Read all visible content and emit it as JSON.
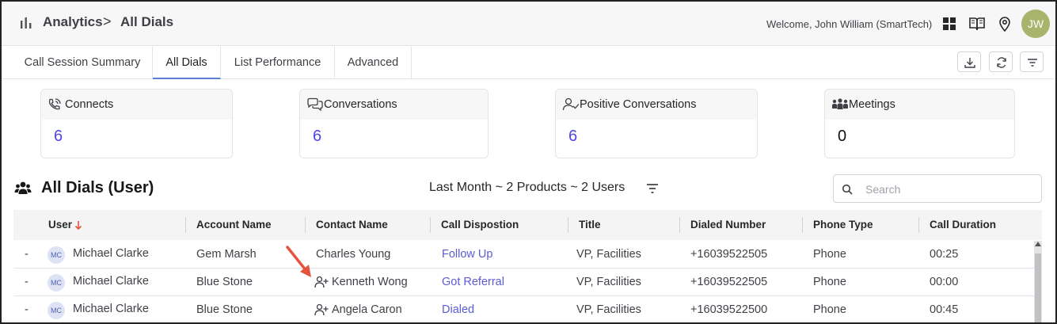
{
  "header": {
    "app": "Analytics",
    "separator": ">",
    "page": "All Dials",
    "welcome": "Welcome, John William (SmartTech)",
    "avatar_initials": "JW",
    "avatar_color": "#a8b36b",
    "icons": [
      "bar-chart-icon",
      "grid-icon",
      "book-icon",
      "location-pin-icon"
    ]
  },
  "tabs": [
    {
      "label": "Call Session Summary",
      "active": false
    },
    {
      "label": "All Dials",
      "active": true
    },
    {
      "label": "List Performance",
      "active": false
    },
    {
      "label": "Advanced",
      "active": false
    }
  ],
  "toolbar": {
    "icons": [
      "download-icon",
      "refresh-icon",
      "filter-lines-icon"
    ]
  },
  "kpis": [
    {
      "label": "Connects",
      "value": "6",
      "icon": "phone-connect-icon"
    },
    {
      "label": "Conversations",
      "value": "6",
      "icon": "chat-bubbles-icon"
    },
    {
      "label": "Positive Conversations",
      "value": "6",
      "icon": "user-check-icon"
    },
    {
      "label": "Meetings",
      "value": "0",
      "icon": "people-group-icon"
    }
  ],
  "section": {
    "title": "All Dials (User)",
    "filter_summary": "Last Month ~ 2 Products ~ 2 Users",
    "search_placeholder": "Search"
  },
  "table": {
    "columns": [
      "User",
      "Account Name",
      "Contact Name",
      "Call Dispostion",
      "Title",
      "Dialed Number",
      "Phone Type",
      "Call Duration"
    ],
    "sort_column": "User",
    "rows": [
      {
        "expand": "-",
        "initials": "MC",
        "user": "Michael Clarke",
        "account": "Gem Marsh",
        "contact": "Charles Young",
        "contact_icon": false,
        "disposition": "Follow Up",
        "title": "VP, Facilities",
        "dialed": "+16039522505",
        "phone_type": "Phone",
        "duration": "00:25"
      },
      {
        "expand": "-",
        "initials": "MC",
        "user": "Michael Clarke",
        "account": "Blue Stone",
        "contact": "Kenneth Wong",
        "contact_icon": true,
        "disposition": "Got Referral",
        "title": "VP, Facilities",
        "dialed": "+16039522505",
        "phone_type": "Phone",
        "duration": "00:00"
      },
      {
        "expand": "-",
        "initials": "MC",
        "user": "Michael Clarke",
        "account": "Blue Stone",
        "contact": "Angela Caron",
        "contact_icon": true,
        "disposition": "Dialed",
        "title": "VP, Facilities",
        "dialed": "+16039522500",
        "phone_type": "Phone",
        "duration": "00:45"
      }
    ]
  },
  "colors": {
    "accent": "#4f46e5",
    "link": "#5b5bd6",
    "sort_arrow": "#e5533d",
    "annotation_arrow": "#e5533d"
  }
}
